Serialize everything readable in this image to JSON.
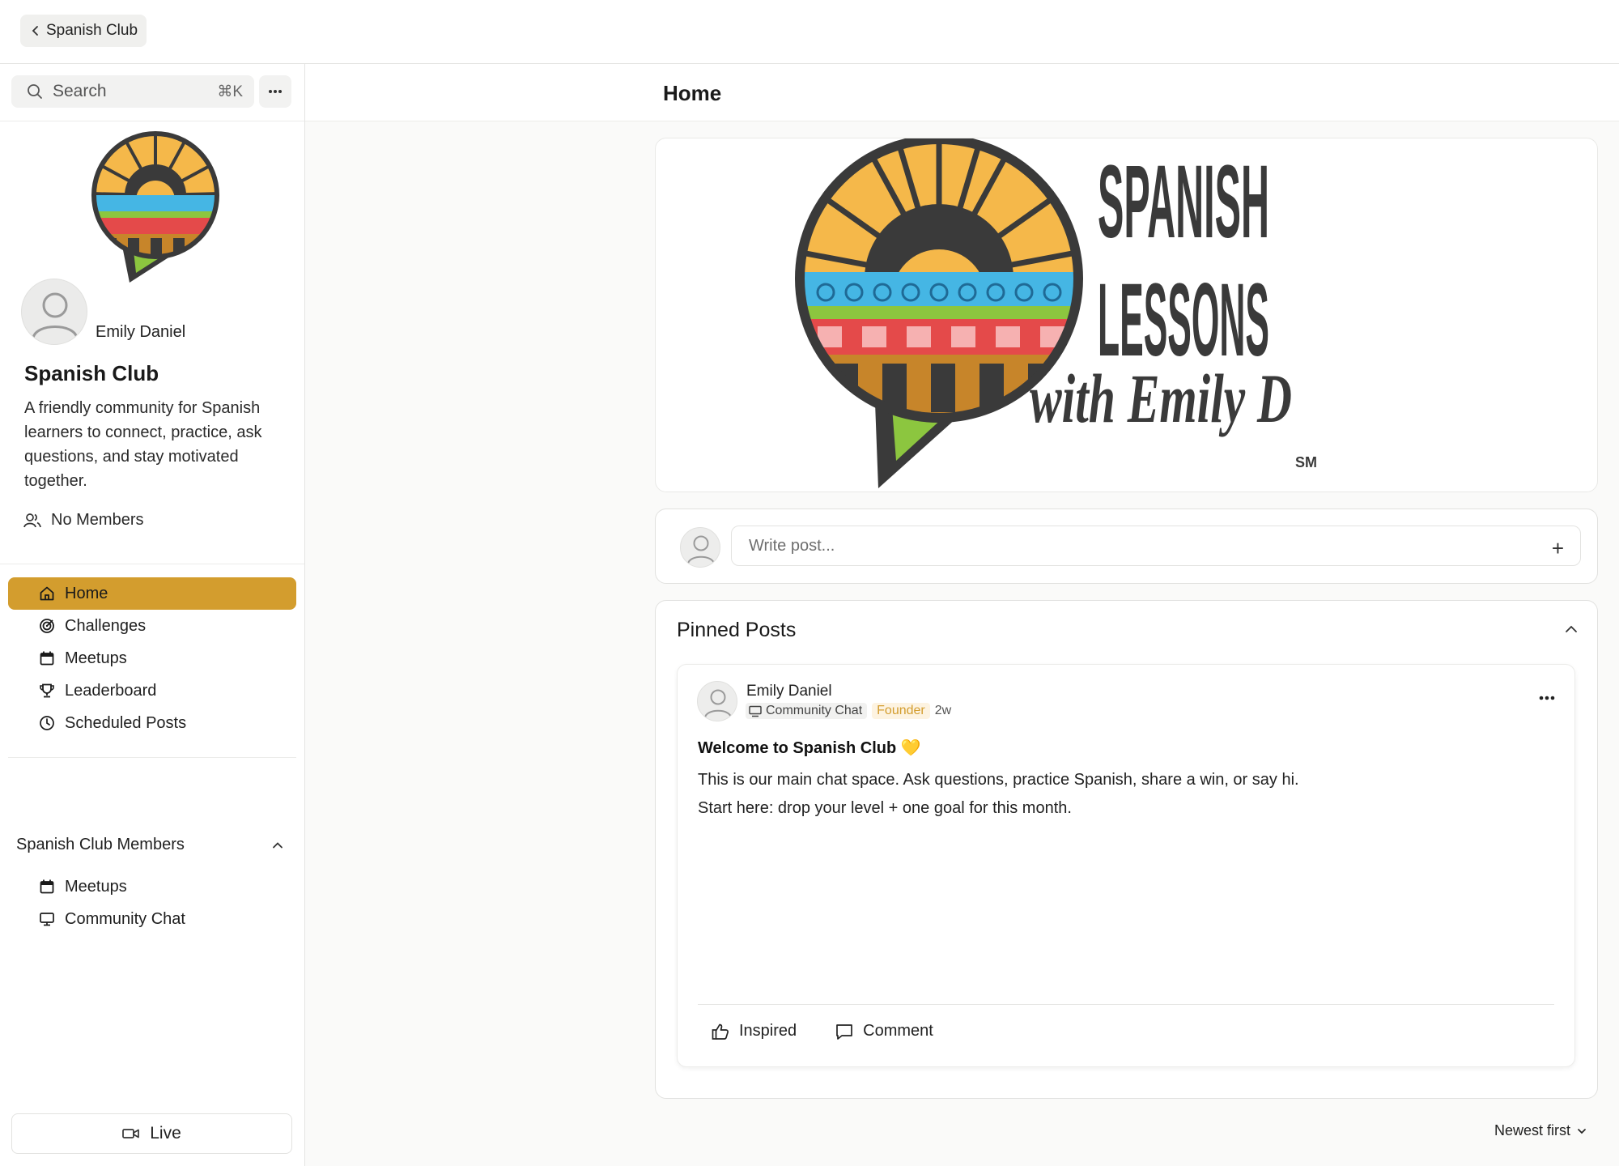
{
  "topbar": {
    "back_label": "Spanish Club"
  },
  "sidebar": {
    "search_placeholder": "Search",
    "search_shortcut": "⌘K",
    "owner_name": "Emily Daniel",
    "club_title": "Spanish Club",
    "club_description": "A friendly community for Spanish learners to connect, practice, ask questions, and stay motivated together.",
    "members_label": "No Members",
    "nav": [
      {
        "label": "Home",
        "icon": "home-icon",
        "active": true
      },
      {
        "label": "Challenges",
        "icon": "target-icon"
      },
      {
        "label": "Meetups",
        "icon": "calendar-icon"
      },
      {
        "label": "Leaderboard",
        "icon": "trophy-icon"
      },
      {
        "label": "Scheduled Posts",
        "icon": "clock-icon"
      }
    ],
    "section_title": "Spanish Club Members",
    "section_items": [
      {
        "label": "Meetups",
        "icon": "calendar-icon"
      },
      {
        "label": "Community Chat",
        "icon": "monitor-icon"
      }
    ],
    "live_label": "Live"
  },
  "main": {
    "page_title": "Home",
    "banner": {
      "line1": "SPANISH",
      "line2": "LESSONS",
      "line3": "with Emily D",
      "mark": "SM"
    },
    "composer": {
      "placeholder": "Write post..."
    },
    "pinned": {
      "title": "Pinned Posts",
      "post": {
        "author": "Emily Daniel",
        "channel": "Community Chat",
        "role": "Founder",
        "age": "2w",
        "title": "Welcome to Spanish Club 💛",
        "body_line1": "This is our main chat space. Ask questions, practice Spanish, share a win, or say hi.",
        "body_line2": "Start here: drop your level + one goal for this month.",
        "action_inspired": "Inspired",
        "action_comment": "Comment"
      }
    },
    "sort_label": "Newest first"
  },
  "colors": {
    "accent": "#d39d2e",
    "logo_dark": "#3a3a3a",
    "logo_sun": "#f5b84a"
  }
}
